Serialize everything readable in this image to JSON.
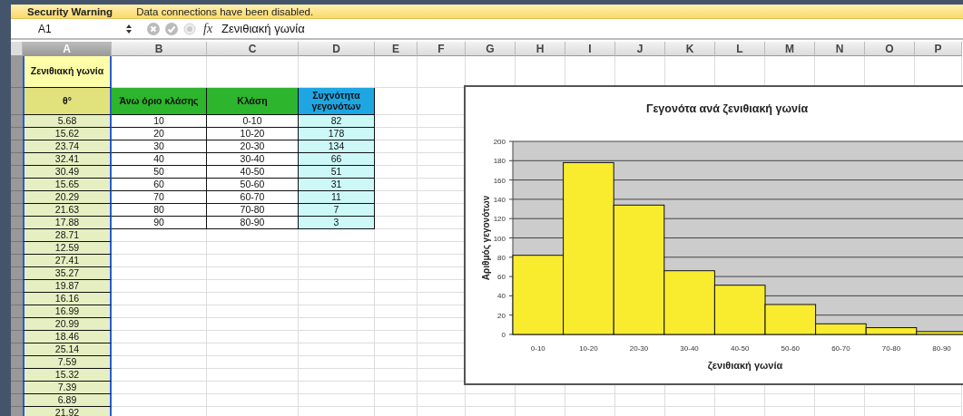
{
  "warning": {
    "title": "Security Warning",
    "message": "Data connections have been disabled."
  },
  "formula_bar": {
    "cell_ref": "A1",
    "fx": "fx",
    "formula": "Ζενιθιακή γωνία"
  },
  "columns": [
    {
      "label": "A",
      "selected": true
    },
    {
      "label": "B",
      "selected": false
    },
    {
      "label": "C",
      "selected": false
    },
    {
      "label": "D",
      "selected": false
    },
    {
      "label": "E",
      "selected": false
    },
    {
      "label": "F",
      "selected": false
    },
    {
      "label": "G",
      "selected": false
    },
    {
      "label": "H",
      "selected": false
    },
    {
      "label": "I",
      "selected": false
    },
    {
      "label": "J",
      "selected": false
    },
    {
      "label": "K",
      "selected": false
    },
    {
      "label": "L",
      "selected": false
    },
    {
      "label": "M",
      "selected": false
    },
    {
      "label": "N",
      "selected": false
    },
    {
      "label": "O",
      "selected": false
    },
    {
      "label": "P",
      "selected": false
    }
  ],
  "title_cell": "Ζενιθιακή γωνία",
  "headers": [
    "θ°",
    "Άνω όριο κλάσης",
    "Κλάση",
    "Συχνότητα γεγονότων"
  ],
  "angles": [
    "5.68",
    "15.62",
    "23.74",
    "32.41",
    "30.49",
    "15.65",
    "20.29",
    "21.63",
    "17.88",
    "28.71",
    "12.59",
    "27.41",
    "35.27",
    "19.87",
    "16.16",
    "16.99",
    "20.99",
    "18.46",
    "25.14",
    "7.59",
    "15.32",
    "7.39",
    "6.89",
    "21.92"
  ],
  "classes": [
    {
      "upper": "10",
      "range": "0-10",
      "frequency": "82"
    },
    {
      "upper": "20",
      "range": "10-20",
      "frequency": "178"
    },
    {
      "upper": "30",
      "range": "20-30",
      "frequency": "134"
    },
    {
      "upper": "40",
      "range": "30-40",
      "frequency": "66"
    },
    {
      "upper": "50",
      "range": "40-50",
      "frequency": "51"
    },
    {
      "upper": "60",
      "range": "50-60",
      "frequency": "31"
    },
    {
      "upper": "70",
      "range": "60-70",
      "frequency": "11"
    },
    {
      "upper": "80",
      "range": "70-80",
      "frequency": "7"
    },
    {
      "upper": "90",
      "range": "80-90",
      "frequency": "3"
    }
  ],
  "chart": {
    "chart_data": {
      "type": "bar",
      "title": "Γεγονότα ανά ζενιθιακή γωνία",
      "xlabel": "ζενιθιακή γωνία",
      "ylabel": "Αριθμός γεγονότων",
      "categories": [
        "0-10",
        "10-20",
        "20-30",
        "30-40",
        "40-50",
        "50-60",
        "60-70",
        "70-80",
        "80-90"
      ],
      "grid": true,
      "series": [
        {
          "color": "#f9ec2f",
          "values": [
            82,
            178,
            134,
            66,
            51,
            31,
            11,
            7,
            3
          ]
        }
      ],
      "ylim": [
        0,
        200
      ],
      "yticks": [
        0,
        20,
        40,
        60,
        80,
        100,
        120,
        140,
        160,
        180,
        200
      ]
    }
  }
}
